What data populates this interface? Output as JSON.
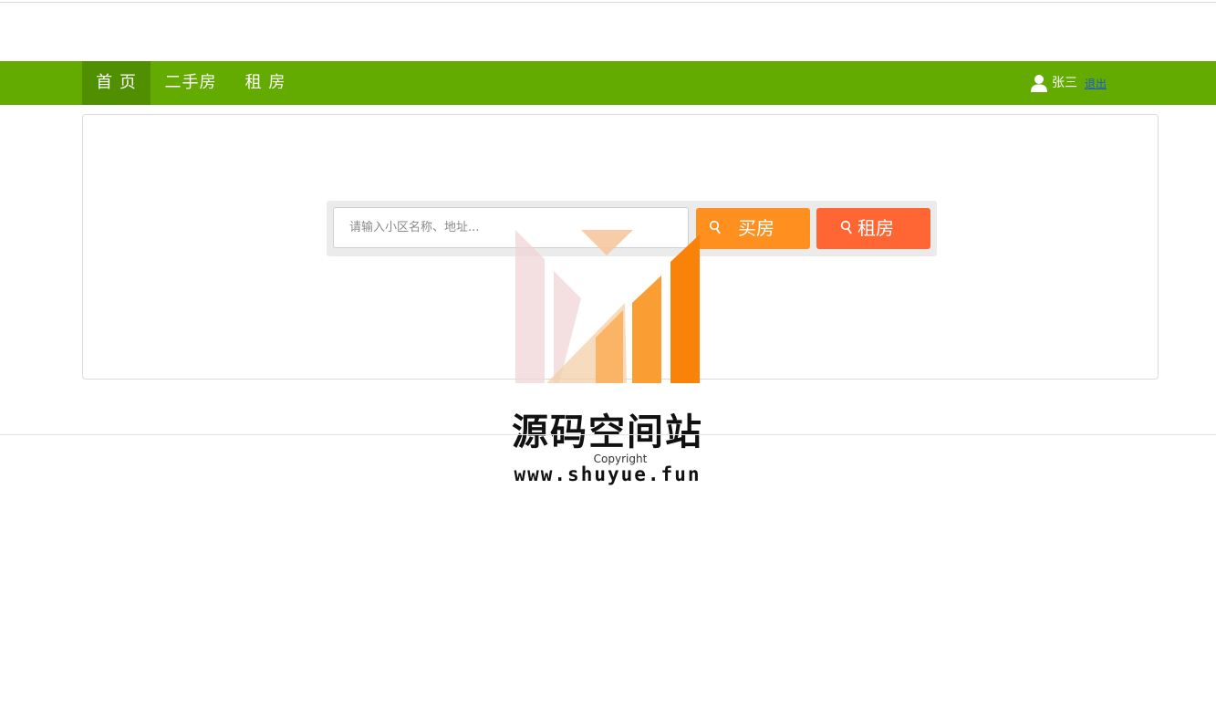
{
  "nav": {
    "items": [
      {
        "label": "首 页",
        "active": true
      },
      {
        "label": "二手房",
        "active": false
      },
      {
        "label": "租 房",
        "active": false
      }
    ],
    "color": "#63ab00",
    "active_color": "#4f8f00"
  },
  "user": {
    "icon": "user-icon",
    "name": "张三",
    "logout_label": "退出"
  },
  "search": {
    "placeholder": "请输入小区名称、地址...",
    "value": "",
    "buy_button": {
      "label": "买房",
      "icon": "search-icon",
      "color": "#ff8f1f"
    },
    "rent_button": {
      "label": "租房",
      "icon": "search-icon",
      "color": "#ff6633"
    }
  },
  "watermark": {
    "title": "源码空间站",
    "url": "www.shuyue.fun"
  },
  "footer": {
    "copyright": "Copyright"
  }
}
